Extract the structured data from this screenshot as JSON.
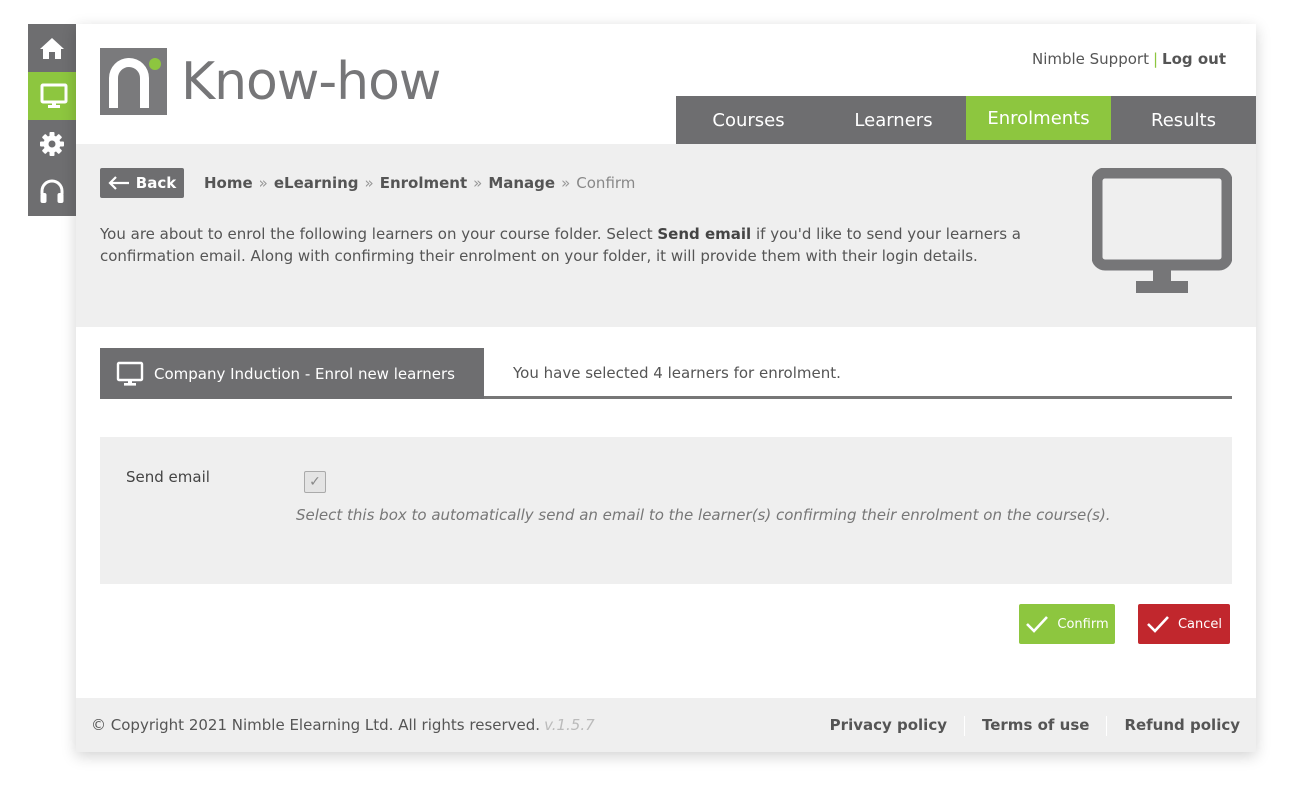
{
  "rail": {
    "items": [
      {
        "icon": "home-icon",
        "active": false
      },
      {
        "icon": "monitor-icon",
        "active": true
      },
      {
        "icon": "gear-icon",
        "active": false
      },
      {
        "icon": "headset-icon",
        "active": false
      }
    ]
  },
  "header": {
    "logo_text": "Know-how",
    "user_name": "Nimble Support",
    "separator": "|",
    "logout_label": "Log out"
  },
  "nav": {
    "tabs": [
      {
        "label": "Courses",
        "active": false
      },
      {
        "label": "Learners",
        "active": false
      },
      {
        "label": "Enrolments",
        "active": true
      },
      {
        "label": "Results",
        "active": false
      }
    ]
  },
  "banner": {
    "back_label": "Back",
    "breadcrumb": [
      "Home",
      "eLearning",
      "Enrolment",
      "Manage",
      "Confirm"
    ],
    "breadcrumb_separator": "»",
    "intro_part1": "You are about to enrol the following learners on your course folder. Select ",
    "intro_bold": "Send email",
    "intro_part2": " if you'd like to send your learners a confirmation email. Along with confirming their enrolment on your folder, it will provide them with their login details."
  },
  "course_tab": {
    "label": "Company Induction - Enrol new learners",
    "selected_text": "You have selected 4 learners for enrolment."
  },
  "form": {
    "send_email_label": "Send email",
    "send_email_checked": true,
    "send_email_help": "Select this box to automatically send an email to the learner(s) confirming their enrolment on the course(s)."
  },
  "actions": {
    "confirm_label": "Confirm",
    "cancel_label": "Cancel"
  },
  "footer": {
    "copyright": "© Copyright 2021 Nimble Elearning Ltd. All rights reserved.",
    "version": "v.1.5.7",
    "links": [
      "Privacy policy",
      "Terms of use",
      "Refund policy"
    ]
  },
  "colors": {
    "accent": "#8dc63f",
    "dark_gray": "#6e6e70",
    "cancel_red": "#c1272d",
    "panel_bg": "#efefef"
  }
}
